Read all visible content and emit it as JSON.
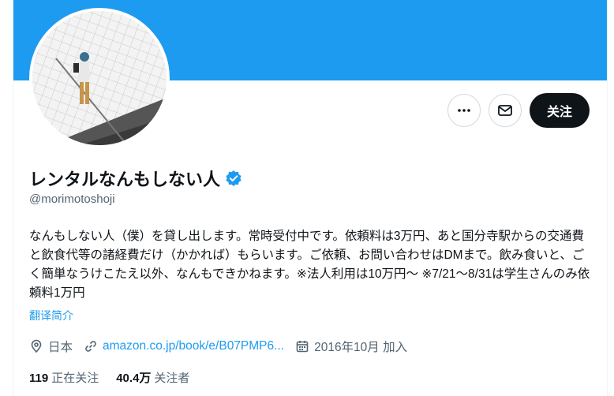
{
  "profile": {
    "display_name": "レンタルなんもしない人",
    "handle": "@morimotoshoji",
    "bio": "なんもしない人（僕）を貸し出します。常時受付中です。依頼料は3万円、あと国分寺駅からの交通費と飲食代等の諸経費だけ（かかれば）もらいます。ご依頼、お問い合わせはDMまで。飲み食いと、ごく簡単なうけこたえ以外、なんもできかねます。※法人利用は10万円〜 ※7/21〜8/31は学生さんのみ依頼料1万円",
    "translate_label": "翻译简介",
    "location": "日本",
    "website": "amazon.co.jp/book/e/B07PMP6...",
    "joined": "2016年10月 加入"
  },
  "actions": {
    "follow_label": "关注"
  },
  "stats": {
    "following_count": "119",
    "following_label": "正在关注",
    "followers_count": "40.4万",
    "followers_label": "关注者"
  },
  "colors": {
    "banner": "#1d9bf0",
    "accent": "#1d9bf0",
    "verified": "#1d9bf0"
  },
  "icons": [
    "more-icon",
    "mail-icon",
    "verified-badge-icon",
    "location-icon",
    "link-icon",
    "calendar-icon"
  ]
}
